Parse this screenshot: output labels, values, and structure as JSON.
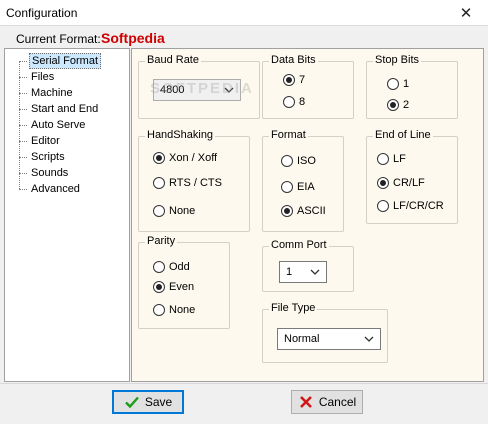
{
  "window": {
    "title": "Configuration"
  },
  "current_format": {
    "label": "Current Format:",
    "value": "Softpedia"
  },
  "tree": {
    "items": [
      {
        "label": "Serial Format",
        "selected": true
      },
      {
        "label": "Files"
      },
      {
        "label": "Machine"
      },
      {
        "label": "Start and End"
      },
      {
        "label": "Auto Serve"
      },
      {
        "label": "Editor"
      },
      {
        "label": "Scripts"
      },
      {
        "label": "Sounds"
      },
      {
        "label": "Advanced"
      }
    ]
  },
  "baud_rate": {
    "title": "Baud Rate",
    "value": "4800"
  },
  "data_bits": {
    "title": "Data Bits",
    "options": [
      "7",
      "8"
    ],
    "selected": "7"
  },
  "stop_bits": {
    "title": "Stop Bits",
    "options": [
      "1",
      "2"
    ],
    "selected": "2"
  },
  "handshaking": {
    "title": "HandShaking",
    "options": [
      "Xon / Xoff",
      "RTS / CTS",
      "None"
    ],
    "selected": "Xon / Xoff"
  },
  "format": {
    "title": "Format",
    "options": [
      "ISO",
      "EIA",
      "ASCII"
    ],
    "selected": "ASCII"
  },
  "end_of_line": {
    "title": "End of Line",
    "options": [
      "LF",
      "CR/LF",
      "LF/CR/CR"
    ],
    "selected": "CR/LF"
  },
  "parity": {
    "title": "Parity",
    "options": [
      "Odd",
      "Even",
      "None"
    ],
    "selected": "Even"
  },
  "comm_port": {
    "title": "Comm Port",
    "value": "1"
  },
  "file_type": {
    "title": "File Type",
    "value": "Normal"
  },
  "buttons": {
    "save": "Save",
    "cancel": "Cancel"
  },
  "colors": {
    "format_value": "#d00000",
    "panel_bg": "#fdf9ef",
    "selection": "#cce8ff",
    "default_button_border": "#0078d7"
  }
}
